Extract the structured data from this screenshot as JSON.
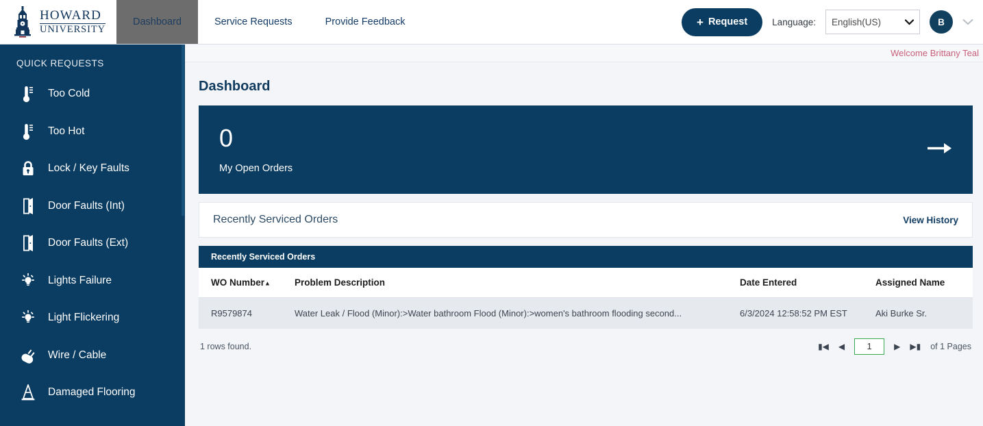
{
  "header": {
    "brand_line1": "HOWARD",
    "brand_line2": "UNIVERSITY",
    "nav": [
      {
        "label": "Dashboard",
        "active": true
      },
      {
        "label": "Service Requests",
        "active": false
      },
      {
        "label": "Provide Feedback",
        "active": false
      }
    ],
    "request_button": "Request",
    "language_label": "Language:",
    "language_value": "English(US)",
    "avatar_initial": "B"
  },
  "sidebar": {
    "title": "QUICK REQUESTS",
    "items": [
      {
        "label": "Too Cold",
        "icon": "thermometer-icon"
      },
      {
        "label": "Too Hot",
        "icon": "thermometer-icon"
      },
      {
        "label": "Lock / Key Faults",
        "icon": "lock-icon"
      },
      {
        "label": "Door Faults (Int)",
        "icon": "door-icon"
      },
      {
        "label": "Door Faults (Ext)",
        "icon": "door-icon"
      },
      {
        "label": "Lights Failure",
        "icon": "lightbulb-icon"
      },
      {
        "label": "Light Flickering",
        "icon": "lightbulb-icon"
      },
      {
        "label": "Wire / Cable",
        "icon": "plug-icon"
      },
      {
        "label": "Damaged Flooring",
        "icon": "traffic-cone-icon"
      }
    ]
  },
  "main": {
    "welcome": "Welcome Brittany Teal",
    "page_title": "Dashboard",
    "kpi": {
      "value": "0",
      "label": "My Open Orders",
      "arrow_icon": "arrow-right-icon"
    },
    "panel": {
      "title": "Recently Serviced Orders",
      "view_history": "View History"
    },
    "grid": {
      "caption": "Recently Serviced Orders",
      "columns": [
        "WO Number",
        "Problem Description",
        "Date Entered",
        "Assigned Name"
      ],
      "sort_column": "WO Number",
      "sort_direction": "asc",
      "rows": [
        {
          "wo_number": "R9579874",
          "problem_description": "Water Leak / Flood (Minor):>Water bathroom Flood (Minor):>women's bathroom flooding second...",
          "date_entered": "6/3/2024 12:58:52 PM EST",
          "assigned_name": "Aki Burke Sr."
        }
      ],
      "rows_found": "1 rows found.",
      "pagination": {
        "first": "first-page",
        "prev": "previous-page",
        "current_page": "1",
        "next": "next-page",
        "last": "last-page",
        "total_label": "of 1 Pages"
      }
    }
  },
  "colors": {
    "brand_navy": "#0b3c61",
    "accent_green": "#34a853",
    "welcome_pink": "#c9607a",
    "tab_active_gray": "#6d6d6d"
  }
}
